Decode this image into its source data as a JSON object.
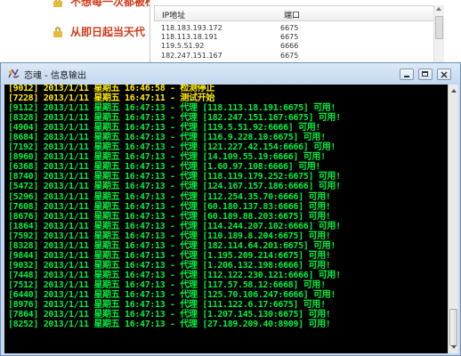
{
  "background": {
    "left_items": [
      {
        "label": "不想每一次都被检测"
      },
      {
        "label": "从即日起当天代"
      }
    ],
    "table": {
      "headers": [
        "IP地址",
        "端口"
      ],
      "rows": [
        {
          "ip": "118.183.193.172",
          "port": "6675"
        },
        {
          "ip": "118.113.18.191",
          "port": "6675"
        },
        {
          "ip": "119.5.51.92",
          "port": "6666"
        },
        {
          "ip": "182.247.151.167",
          "port": "6675"
        }
      ]
    }
  },
  "window": {
    "title": "恋魂 - 信息输出",
    "icon": "app-icon",
    "buttons": {
      "minimize": "minimize-icon",
      "maximize": "maximize-icon",
      "close": "close-icon"
    }
  },
  "colors": {
    "header_lines": "#ffee00",
    "proxy_lines": "#00f040",
    "console_bg": "#000000"
  },
  "log": [
    {
      "text": "[9012] 2013/1/11 星期五 16:46:58 - 检测停止",
      "kind": "header"
    },
    {
      "text": "[7228] 2013/1/11 星期五 16:47:11 - 测试开始",
      "kind": "header"
    },
    {
      "text": "[9112] 2013/1/11 星期五 16:47:13 - 代理 [118.113.18.191:6675] 可用!",
      "kind": "proxy"
    },
    {
      "text": "[8328] 2013/1/11 星期五 16:47:13 - 代理 [182.247.151.167:6675] 可用!",
      "kind": "proxy"
    },
    {
      "text": "[4904] 2013/1/11 星期五 16:47:13 - 代理 [119.5.51.92:6666] 可用!",
      "kind": "proxy"
    },
    {
      "text": "[8684] 2013/1/11 星期五 16:47:13 - 代理 [116.9.228.10:6675] 可用!",
      "kind": "proxy"
    },
    {
      "text": "[7192] 2013/1/11 星期五 16:47:13 - 代理 [121.227.42.154:6666] 可用!",
      "kind": "proxy"
    },
    {
      "text": "[8960] 2013/1/11 星期五 16:47:13 - 代理 [14.109.55.19:6666] 可用!",
      "kind": "proxy"
    },
    {
      "text": "[6368] 2013/1/11 星期五 16:47:13 - 代理 [1.60.97.108:6666] 可用!",
      "kind": "proxy"
    },
    {
      "text": "[8740] 2013/1/11 星期五 16:47:13 - 代理 [118.119.179.252:6675] 可用!",
      "kind": "proxy"
    },
    {
      "text": "[5472] 2013/1/11 星期五 16:47:13 - 代理 [124.167.157.186:6666] 可用!",
      "kind": "proxy"
    },
    {
      "text": "[5296] 2013/1/11 星期五 16:47:13 - 代理 [112.254.35.70:6666] 可用!",
      "kind": "proxy"
    },
    {
      "text": "[7608] 2013/1/11 星期五 16:47:13 - 代理 [60.180.137.83:6666] 可用!",
      "kind": "proxy"
    },
    {
      "text": "[8676] 2013/1/11 星期五 16:47:13 - 代理 [60.189.88.203:6675] 可用!",
      "kind": "proxy"
    },
    {
      "text": "[1864] 2013/1/11 星期五 16:47:13 - 代理 [114.244.207.102:6666] 可用!",
      "kind": "proxy"
    },
    {
      "text": "[7592] 2013/1/11 星期五 16:47:13 - 代理 [110.189.8.204:6675] 可用!",
      "kind": "proxy"
    },
    {
      "text": "[8328] 2013/1/11 星期五 16:47:13 - 代理 [182.114.64.201:6675] 可用!",
      "kind": "proxy"
    },
    {
      "text": "[9844] 2013/1/11 星期五 16:47:13 - 代理 [1.195.209.214:6675] 可用!",
      "kind": "proxy"
    },
    {
      "text": "[9032] 2013/1/11 星期五 16:47:13 - 代理 [1.206.132.198:6666] 可用!",
      "kind": "proxy"
    },
    {
      "text": "[7448] 2013/1/11 星期五 16:47:13 - 代理 [112.122.230.121:6666] 可用!",
      "kind": "proxy"
    },
    {
      "text": "[7512] 2013/1/11 星期五 16:47:13 - 代理 [117.57.58.12:6668] 可用!",
      "kind": "proxy"
    },
    {
      "text": "[6440] 2013/1/11 星期五 16:47:13 - 代理 [125.70.106.247:6666] 可用!",
      "kind": "proxy"
    },
    {
      "text": "[8976] 2013/1/11 星期五 16:47:13 - 代理 [111.122.6.17:6675] 可用!",
      "kind": "proxy"
    },
    {
      "text": "[7864] 2013/1/11 星期五 16:47:13 - 代理 [1.207.145.130:6675] 可用!",
      "kind": "proxy"
    },
    {
      "text": "[8252] 2013/1/11 星期五 16:47:13 - 代理 [27.189.209.40:8909] 可用!",
      "kind": "proxy"
    }
  ]
}
